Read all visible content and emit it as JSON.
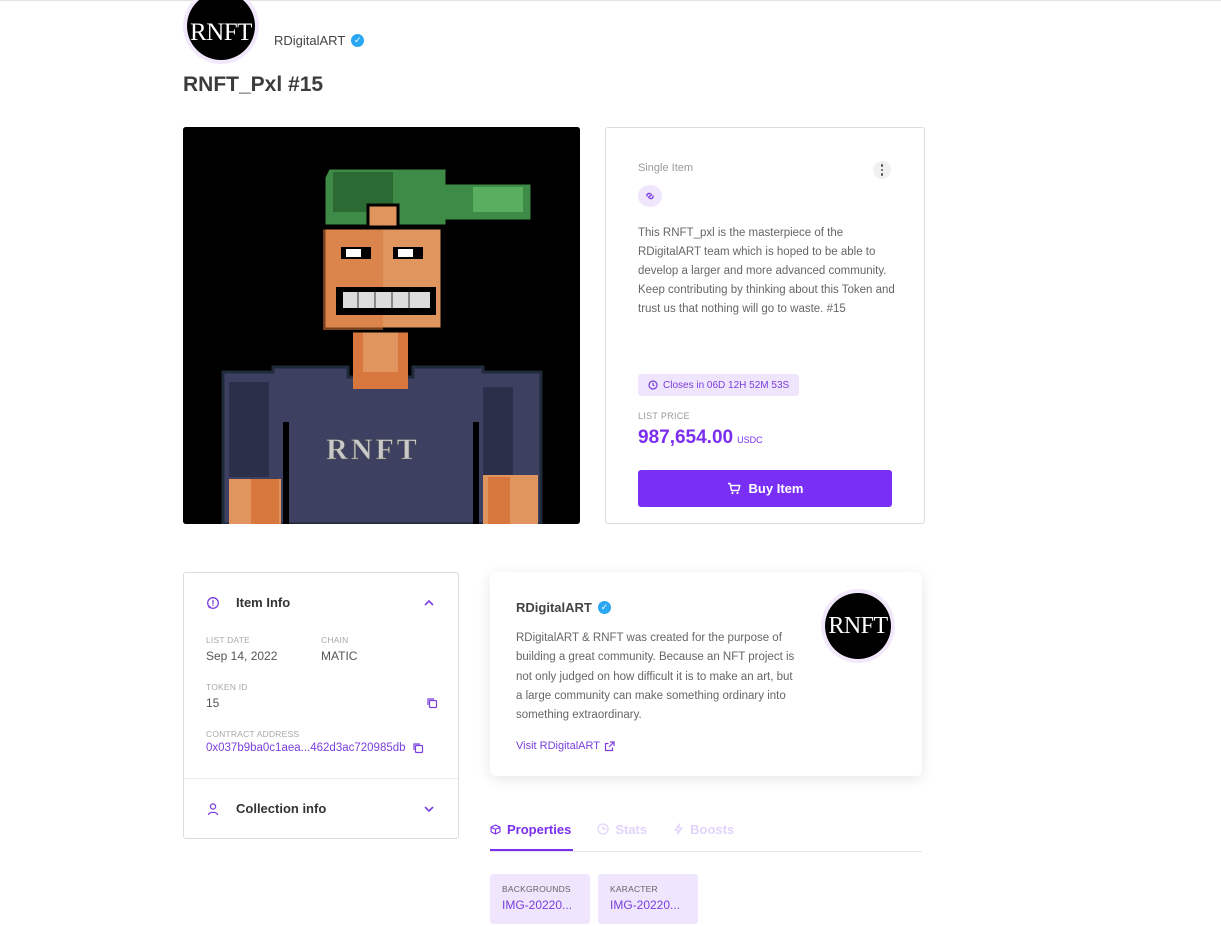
{
  "header": {
    "avatar_text": "RNFT",
    "creator_name": "RDigitalART",
    "title": "RNFT_Pxl #15"
  },
  "nft_image": {
    "shirt_text": "RNFT"
  },
  "buy_card": {
    "item_type": "Single Item",
    "description": "This RNFT_pxl is the masterpiece of the RDigitalART team which is hoped to be able to develop a larger and more advanced community. Keep contributing by thinking about this Token and trust us that nothing will go to waste. #15",
    "countdown": "Closes in 06D 12H 52M 53S",
    "price_label": "LIST PRICE",
    "price": "987,654.00",
    "currency": "USDC",
    "buy_label": "Buy Item"
  },
  "item_info": {
    "title": "Item Info",
    "list_date_label": "LIST DATE",
    "list_date": "Sep 14, 2022",
    "chain_label": "CHAIN",
    "chain": "MATIC",
    "token_id_label": "TOKEN ID",
    "token_id": "15",
    "contract_label": "CONTRACT ADDRESS",
    "contract": "0x037b9ba0c1aea...462d3ac720985db",
    "collection_title": "Collection info"
  },
  "creator_card": {
    "name": "RDigitalART",
    "description": "RDigitalART & RNFT was created for the purpose of building a great community. Because an NFT project is not only judged on how difficult it is to make an art, but a large community can make something ordinary into something extraordinary.",
    "link": "Visit RDigitalART",
    "avatar_text": "RNFT"
  },
  "tabs": [
    {
      "label": "Properties",
      "icon": "cube-icon",
      "active": true
    },
    {
      "label": "Stats",
      "icon": "stats-icon",
      "active": false
    },
    {
      "label": "Boosts",
      "icon": "bolt-icon",
      "active": false
    }
  ],
  "properties": [
    {
      "label": "BACKGROUNDS",
      "value": "IMG-20220..."
    },
    {
      "label": "KARACTER",
      "value": "IMG-20220..."
    }
  ],
  "colors": {
    "accent": "#7a2ff7",
    "accent_light": "#efe5fd",
    "verified": "#2aa7f2"
  }
}
